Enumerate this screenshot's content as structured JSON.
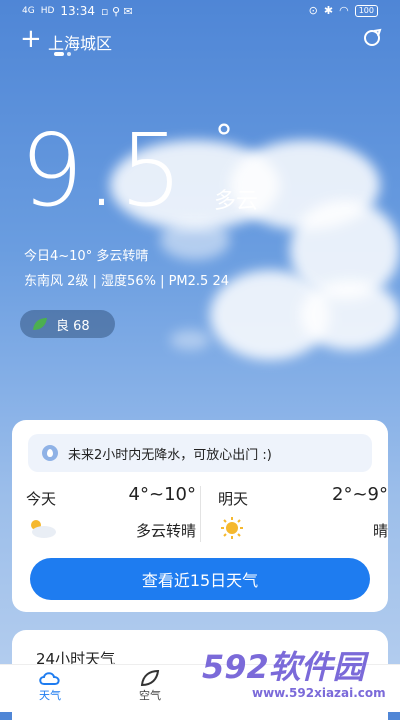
{
  "status_bar": {
    "network": "4G",
    "hd": "HD",
    "time": "13:34",
    "battery": "100"
  },
  "top_bar": {
    "city": "上海城区"
  },
  "current": {
    "temperature": "9.5",
    "degree_symbol": "°",
    "condition": "多云",
    "range_line": "今日4~10° 多云转晴",
    "detail_line": "东南风 2级 | 湿度56% | PM2.5 24",
    "aqi_label": "良 68"
  },
  "card": {
    "notice": "未来2小时内无降水，可放心出门 :)",
    "today": {
      "label": "今天",
      "range": "4°~10°",
      "desc": "多云转晴"
    },
    "tomorrow": {
      "label": "明天",
      "range": "2°~9°",
      "desc": "晴"
    },
    "button": "查看近15日天气"
  },
  "hourly": {
    "title": "24小时天气"
  },
  "tabs": [
    {
      "label": "天气"
    },
    {
      "label": "空气"
    },
    {
      "label": ""
    },
    {
      "label": ""
    }
  ],
  "watermark": {
    "big": "592软件园",
    "small": "www.592xiazai.com"
  },
  "colors": {
    "accent": "#1e7cf0",
    "aqi_leaf": "#4caf50",
    "sun": "#f5b82e"
  }
}
